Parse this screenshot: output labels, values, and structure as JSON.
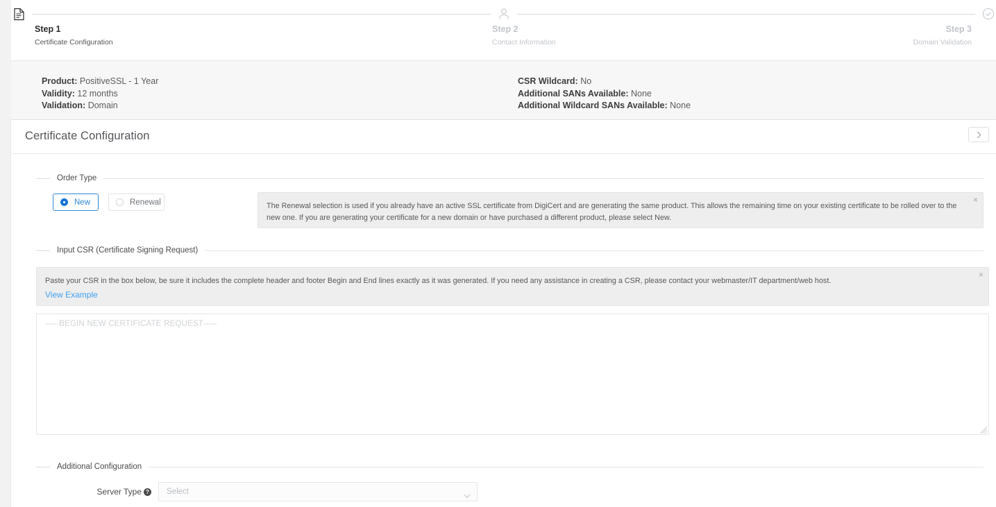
{
  "stepper": {
    "steps": [
      {
        "icon": "document-icon",
        "title": "Step 1",
        "subtitle": "Certificate Configuration",
        "state": "active"
      },
      {
        "icon": "person-icon",
        "title": "Step 2",
        "subtitle": "Contact Information",
        "state": "inactive"
      },
      {
        "icon": "check-circle-icon",
        "title": "Step 3",
        "subtitle": "Domain Validation",
        "state": "inactive"
      }
    ]
  },
  "summary": {
    "left": [
      {
        "label": "Product:",
        "value": "PositiveSSL - 1 Year"
      },
      {
        "label": "Validity:",
        "value": "12 months"
      },
      {
        "label": "Validation:",
        "value": "Domain"
      }
    ],
    "right": [
      {
        "label": "CSR Wildcard:",
        "value": "No"
      },
      {
        "label": "Additional SANs Available:",
        "value": "None"
      },
      {
        "label": "Additional Wildcard SANs Available:",
        "value": "None"
      }
    ]
  },
  "panel": {
    "title": "Certificate Configuration",
    "collapse_icon": "chevron-right-icon"
  },
  "order_type": {
    "legend": "Order Type",
    "options": [
      {
        "label": "New",
        "selected": true
      },
      {
        "label": "Renewal",
        "selected": false
      }
    ],
    "alert": {
      "text": "The Renewal selection is used if you already have an active SSL certificate from DigiCert and are generating the same product. This allows the remaining time on your existing certificate to be rolled over to the new one. If you are generating your certificate for a new domain or have purchased a different product, please select New.",
      "close_label": "×"
    }
  },
  "input_csr": {
    "legend": "Input CSR (Certificate Signing Request)",
    "alert": {
      "text": "Paste your CSR in the box below, be sure it includes the complete header and footer Begin and End lines exactly as it was generated. If you need any assistance in creating a CSR, please contact your webmaster/IT department/web host.",
      "link_label": "View Example",
      "close_label": "×"
    },
    "textarea": {
      "value": "",
      "placeholder": "-----BEGIN NEW CERTIFICATE REQUEST-----"
    }
  },
  "additional_configuration": {
    "legend": "Additional Configuration",
    "server_type": {
      "label": "Server Type",
      "help_icon": "question-mark-icon",
      "value": "",
      "placeholder": "Select"
    }
  },
  "colors": {
    "accent": "#2f86d6",
    "link": "#3ea0f0",
    "page_bg": "#f2f2f3",
    "panel_bg": "#ffffff",
    "alert_bg": "#eeeeee",
    "muted_text": "#c2c5ca"
  }
}
